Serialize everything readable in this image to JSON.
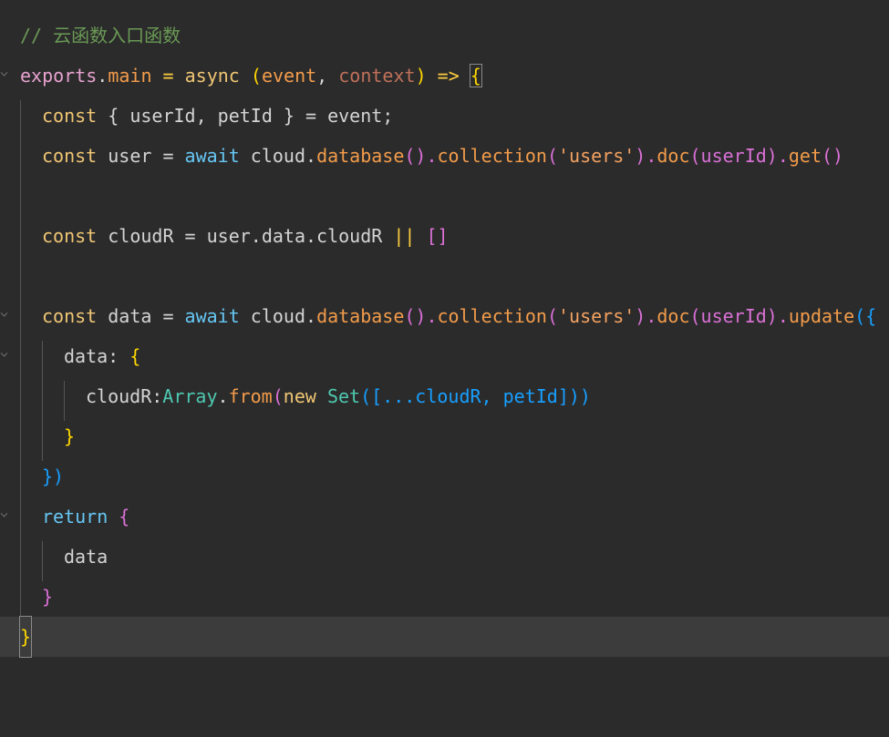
{
  "code": {
    "comment": "// 云函数入口函数",
    "l2": {
      "exports": "exports",
      "dot": ".",
      "main": "main",
      "eq": " = ",
      "async": "async",
      "sp": " ",
      "lp": "(",
      "p1": "event",
      "comma": ", ",
      "p2": "context",
      "rp": ")",
      "arrow": " => ",
      "lb": "{"
    },
    "l3": {
      "const": "const",
      "body": " { userId, petId } = event;"
    },
    "l4": {
      "const": "const",
      "user": " user = ",
      "await": "await",
      "cloud": " cloud.",
      "db": "database",
      "p1": "().",
      "col": "collection",
      "p2": "(",
      "str": "'users'",
      "p3": ").",
      "doc": "doc",
      "p4": "(userId).",
      "get": "get",
      "p5": "()"
    },
    "l6": {
      "const": "const",
      "body": " cloudR = user.data.cloudR ",
      "or": "||",
      "sp": " ",
      "arr": "[]"
    },
    "l8": {
      "const": "const",
      "data": " data = ",
      "await": "await",
      "cloud": " cloud.",
      "db": "database",
      "p1": "().",
      "col": "collection",
      "p2": "(",
      "str": "'users'",
      "p3": ").",
      "doc": "doc",
      "p4": "(userId).",
      "update": "update",
      "p5": "({"
    },
    "l9": {
      "key": "data",
      "colon": ": ",
      "lb": "{"
    },
    "l10": {
      "key": "cloudR",
      "colon": ":",
      "arrcls": "Array",
      "dot": ".",
      "from": "from",
      "lp": "(",
      "new": "new",
      "sp": " ",
      "set": "Set",
      "rest": "([...cloudR, petId]))"
    },
    "l11": {
      "rb": "}"
    },
    "l12": {
      "close": "})"
    },
    "l13": {
      "ret": "return",
      "sp": " ",
      "lb": "{"
    },
    "l14": {
      "data": "data"
    },
    "l15": {
      "rb": "}"
    },
    "l16": {
      "rb": "}"
    }
  }
}
